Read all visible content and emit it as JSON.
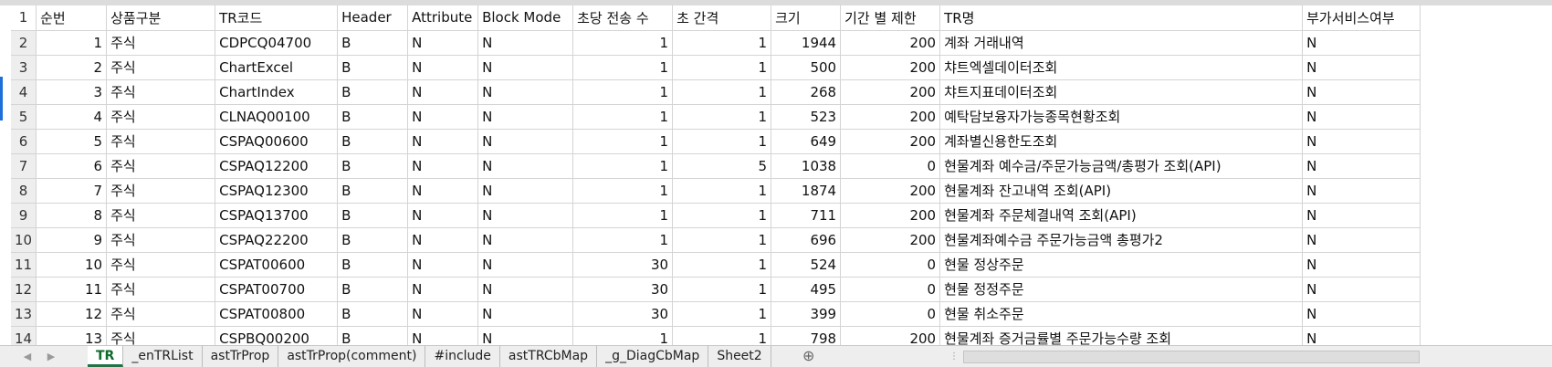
{
  "columns": [
    "순번",
    "상품구분",
    "TR코드",
    "Header",
    "Attribute",
    "Block Mode",
    "초당 전송 수",
    "초 간격",
    "크기",
    "기간 별 제한",
    "TR명",
    "부가서비스여부"
  ],
  "rows": [
    {
      "n": "2",
      "c": [
        "1",
        "주식",
        "CDPCQ04700",
        "B",
        "N",
        "N",
        "1",
        "1",
        "1944",
        "200",
        "계좌 거래내역",
        "N"
      ]
    },
    {
      "n": "3",
      "c": [
        "2",
        "주식",
        "ChartExcel",
        "B",
        "N",
        "N",
        "1",
        "1",
        "500",
        "200",
        "챠트엑셀데이터조회",
        "N"
      ]
    },
    {
      "n": "4",
      "c": [
        "3",
        "주식",
        "ChartIndex",
        "B",
        "N",
        "N",
        "1",
        "1",
        "268",
        "200",
        "챠트지표데이터조회",
        "N"
      ]
    },
    {
      "n": "5",
      "c": [
        "4",
        "주식",
        "CLNAQ00100",
        "B",
        "N",
        "N",
        "1",
        "1",
        "523",
        "200",
        "예탁담보융자가능종목현황조회",
        "N"
      ]
    },
    {
      "n": "6",
      "c": [
        "5",
        "주식",
        "CSPAQ00600",
        "B",
        "N",
        "N",
        "1",
        "1",
        "649",
        "200",
        "계좌별신용한도조회",
        "N"
      ]
    },
    {
      "n": "7",
      "c": [
        "6",
        "주식",
        "CSPAQ12200",
        "B",
        "N",
        "N",
        "1",
        "5",
        "1038",
        "0",
        "현물계좌 예수금/주문가능금액/총평가 조회(API)",
        "N"
      ]
    },
    {
      "n": "8",
      "c": [
        "7",
        "주식",
        "CSPAQ12300",
        "B",
        "N",
        "N",
        "1",
        "1",
        "1874",
        "200",
        "현물계좌 잔고내역 조회(API)",
        "N"
      ]
    },
    {
      "n": "9",
      "c": [
        "8",
        "주식",
        "CSPAQ13700",
        "B",
        "N",
        "N",
        "1",
        "1",
        "711",
        "200",
        "현물계좌 주문체결내역 조회(API)",
        "N"
      ]
    },
    {
      "n": "10",
      "c": [
        "9",
        "주식",
        "CSPAQ22200",
        "B",
        "N",
        "N",
        "1",
        "1",
        "696",
        "200",
        "현물계좌예수금 주문가능금액 총평가2",
        "N"
      ]
    },
    {
      "n": "11",
      "c": [
        "10",
        "주식",
        "CSPAT00600",
        "B",
        "N",
        "N",
        "30",
        "1",
        "524",
        "0",
        "현물 정상주문",
        "N"
      ]
    },
    {
      "n": "12",
      "c": [
        "11",
        "주식",
        "CSPAT00700",
        "B",
        "N",
        "N",
        "30",
        "1",
        "495",
        "0",
        "현물 정정주문",
        "N"
      ]
    },
    {
      "n": "13",
      "c": [
        "12",
        "주식",
        "CSPAT00800",
        "B",
        "N",
        "N",
        "30",
        "1",
        "399",
        "0",
        "현물 취소주문",
        "N"
      ]
    },
    {
      "n": "14",
      "c": [
        "13",
        "주식",
        "CSPBQ00200",
        "B",
        "N",
        "N",
        "1",
        "1",
        "798",
        "200",
        "현물계좌 증거금률별 주문가능수량 조회",
        "N"
      ]
    }
  ],
  "header_row_number": "1",
  "sheet_tabs": [
    "TR",
    "_enTRList",
    "astTrProp",
    "astTrProp(comment)",
    "#include",
    "astTRCbMap",
    "_g_DiagCbMap",
    "Sheet2"
  ],
  "active_tab": "TR",
  "add_sheet_symbol": "⊕",
  "colors": {
    "active_tab_text": "#0e6b2c",
    "accent": "#217346",
    "selection_marker": "#1e6fd9"
  }
}
